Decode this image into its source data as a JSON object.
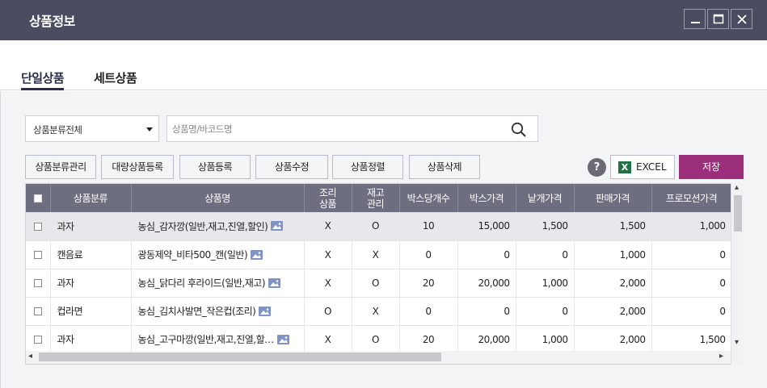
{
  "window": {
    "title": "상품정보"
  },
  "tabs": [
    {
      "label": "단일상품",
      "active": true
    },
    {
      "label": "세트상품",
      "active": false
    }
  ],
  "filters": {
    "category_select": "상품분류전체",
    "search_placeholder": "상품명/바코드명"
  },
  "toolbar": {
    "category_manage": "상품분류관리",
    "bulk_register": "대량상품등록",
    "register": "상품등록",
    "edit": "상품수정",
    "sort": "상품정렬",
    "delete": "상품삭제",
    "help": "?",
    "excel": "EXCEL",
    "save": "저장"
  },
  "colors": {
    "titlebar": "#4a4d62",
    "header": "#6d6f80",
    "save_button": "#9b2f7c",
    "excel_green": "#217346",
    "image_icon": "#7f93c4"
  },
  "table": {
    "headers": {
      "category": "상품분류",
      "name": "상품명",
      "cook_1": "조리",
      "cook_2": "상품",
      "stock_1": "재고",
      "stock_2": "관리",
      "per_box": "박스당개수",
      "box_price": "박스가격",
      "unit_price": "낱개가격",
      "sale_price": "판매가격",
      "promo_price": "프로모션가격"
    },
    "rows": [
      {
        "category": "과자",
        "name": "농심_감자깡(일반,재고,진열,할인)",
        "cook": "X",
        "stock": "O",
        "per_box": "10",
        "box_price": "15,000",
        "unit_price": "1,500",
        "sale_price": "1,500",
        "promo_price": "1,000"
      },
      {
        "category": "캔음료",
        "name": "광동제약_비타500_캔(일반)",
        "cook": "X",
        "stock": "X",
        "per_box": "0",
        "box_price": "0",
        "unit_price": "0",
        "sale_price": "1,000",
        "promo_price": "0"
      },
      {
        "category": "과자",
        "name": "농심_닭다리 후라이드(일반,재고)",
        "cook": "X",
        "stock": "O",
        "per_box": "20",
        "box_price": "20,000",
        "unit_price": "1,000",
        "sale_price": "2,000",
        "promo_price": "0"
      },
      {
        "category": "컵라면",
        "name": "농심_김치사발면_작은컵(조리)",
        "cook": "O",
        "stock": "X",
        "per_box": "0",
        "box_price": "0",
        "unit_price": "0",
        "sale_price": "2,000",
        "promo_price": "0"
      },
      {
        "category": "과자",
        "name": "농심_고구마깡(일반,재고,진열,할…",
        "cook": "X",
        "stock": "O",
        "per_box": "20",
        "box_price": "20,000",
        "unit_price": "1,000",
        "sale_price": "2,000",
        "promo_price": "1,500"
      }
    ]
  }
}
